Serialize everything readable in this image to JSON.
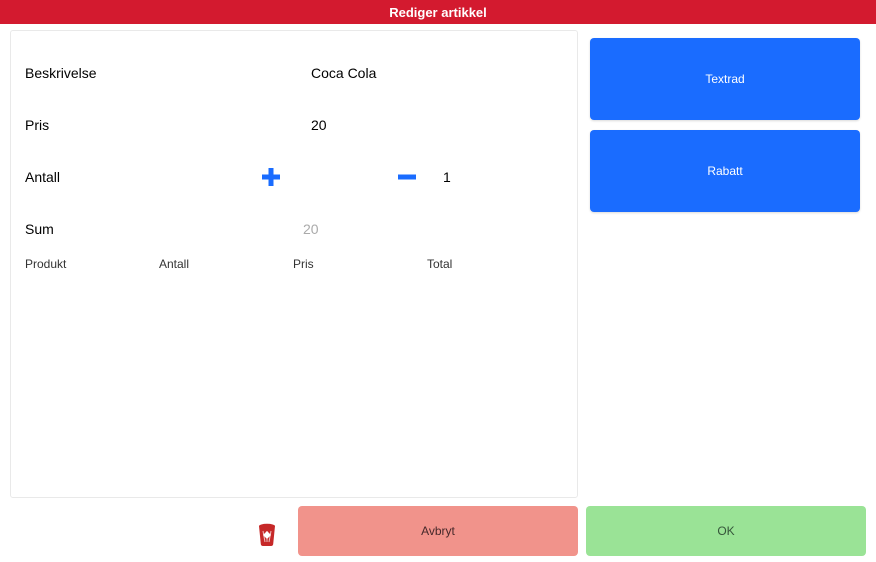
{
  "title": "Rediger artikkel",
  "labels": {
    "description": "Beskrivelse",
    "price": "Pris",
    "quantity": "Antall",
    "sum": "Sum"
  },
  "values": {
    "description": "Coca Cola",
    "price": "20",
    "quantity": "1",
    "sum": "20"
  },
  "columns": {
    "product": "Produkt",
    "quantity": "Antall",
    "price": "Pris",
    "total": "Total"
  },
  "side": {
    "textline": "Textrad",
    "discount": "Rabatt"
  },
  "footer": {
    "cancel": "Avbryt",
    "ok": "OK"
  },
  "colors": {
    "primary": "#1a6cff",
    "danger": "#d31a2f",
    "cancel": "#f1938b",
    "ok": "#9ae396"
  }
}
